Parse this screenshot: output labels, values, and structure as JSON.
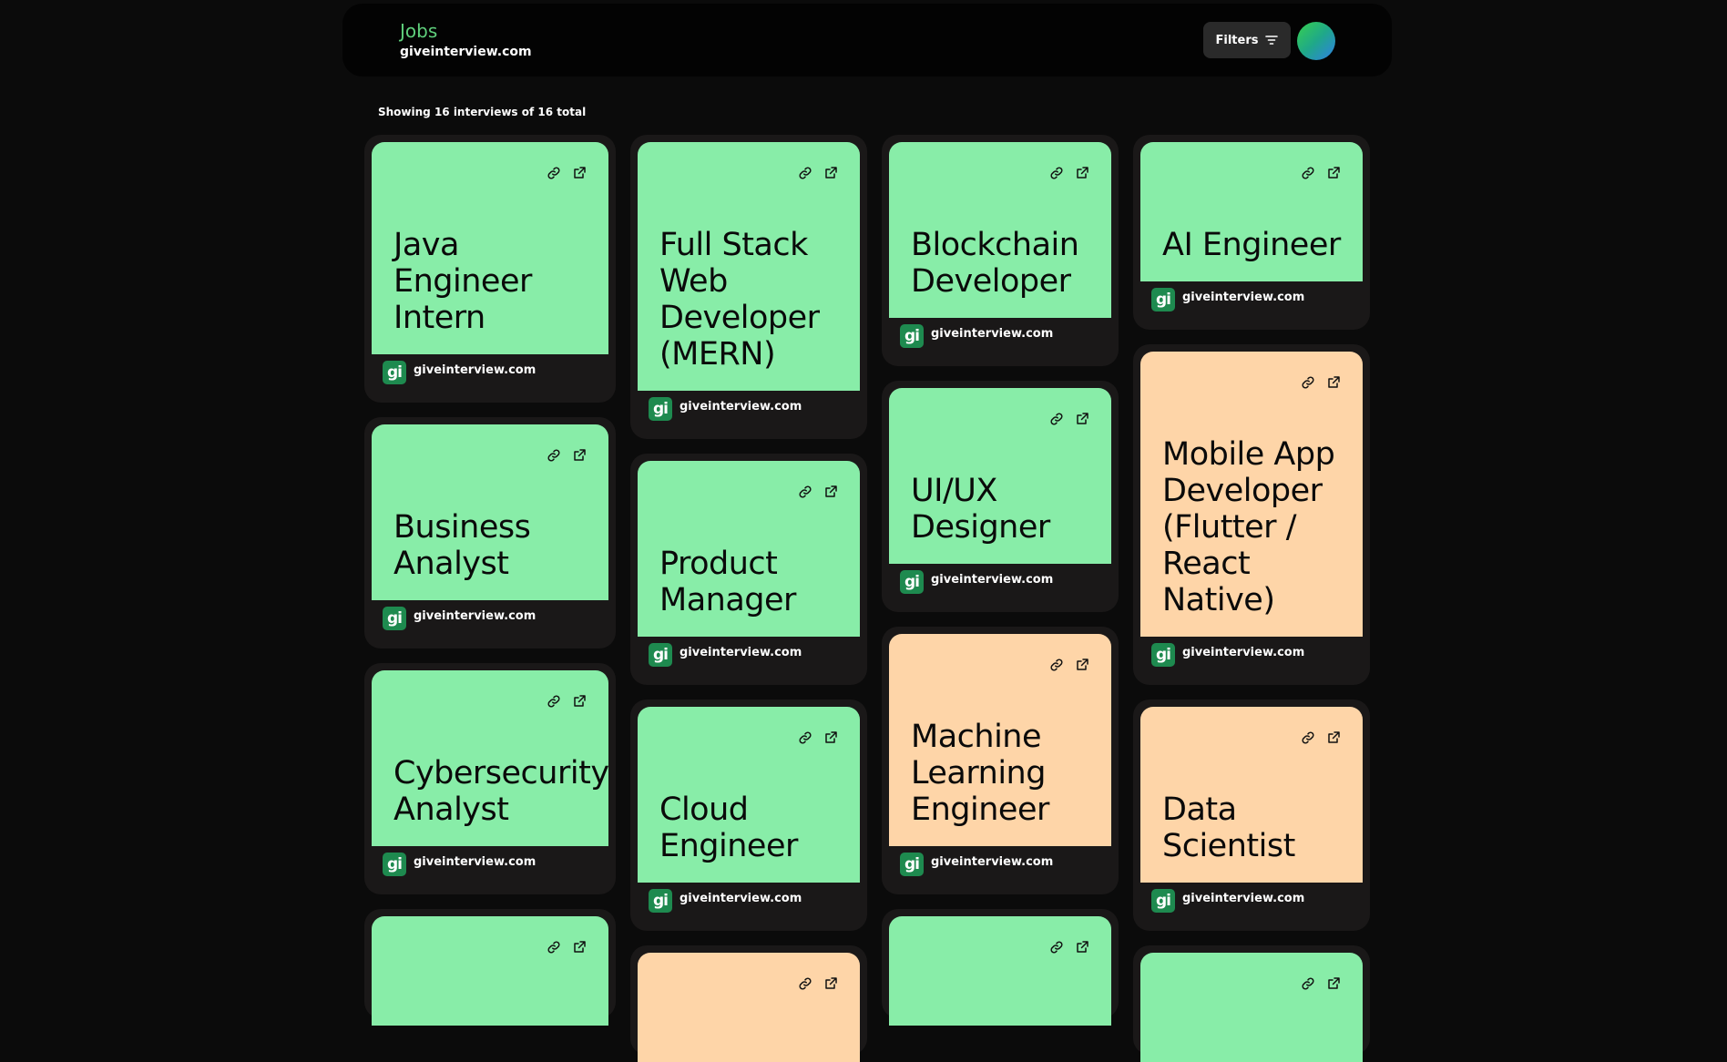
{
  "header": {
    "title": "Jobs",
    "subtitle": "giveinterview.com",
    "filters_label": "Filters"
  },
  "summary": "Showing 16 interviews of 16 total",
  "colors": {
    "green": "#88eda8",
    "peach": "#fed5a8",
    "accent": "#5fd07c"
  },
  "cards": [
    {
      "title": "Java Engineer Intern",
      "site": "giveinterview.com",
      "logo": "gi",
      "color": "green"
    },
    {
      "title": "Full Stack Web Developer (MERN)",
      "site": "giveinterview.com",
      "logo": "gi",
      "color": "green"
    },
    {
      "title": "Blockchain Developer",
      "site": "giveinterview.com",
      "logo": "gi",
      "color": "green"
    },
    {
      "title": "AI Engineer",
      "site": "giveinterview.com",
      "logo": "gi",
      "color": "green"
    },
    {
      "title": "Business Analyst",
      "site": "giveinterview.com",
      "logo": "gi",
      "color": "green"
    },
    {
      "title": "Product Manager",
      "site": "giveinterview.com",
      "logo": "gi",
      "color": "green"
    },
    {
      "title": "UI/UX Designer",
      "site": "giveinterview.com",
      "logo": "gi",
      "color": "green"
    },
    {
      "title": "Mobile App Developer (Flutter / React Native)",
      "site": "giveinterview.com",
      "logo": "gi",
      "color": "peach"
    },
    {
      "title": "Cybersecurity Analyst",
      "site": "giveinterview.com",
      "logo": "gi",
      "color": "green"
    },
    {
      "title": "Cloud Engineer",
      "site": "giveinterview.com",
      "logo": "gi",
      "color": "green"
    },
    {
      "title": "Machine Learning Engineer",
      "site": "giveinterview.com",
      "logo": "gi",
      "color": "peach"
    },
    {
      "title": "Data Scientist",
      "site": "giveinterview.com",
      "logo": "gi",
      "color": "peach"
    },
    {
      "title": "",
      "site": "",
      "logo": "",
      "color": "green"
    },
    {
      "title": "",
      "site": "",
      "logo": "",
      "color": "peach"
    },
    {
      "title": "",
      "site": "",
      "logo": "",
      "color": "green"
    },
    {
      "title": "",
      "site": "",
      "logo": "",
      "color": "green"
    }
  ],
  "icons": {
    "copy": "link-icon",
    "open": "external-link-icon",
    "filters": "filter-lines-icon"
  }
}
